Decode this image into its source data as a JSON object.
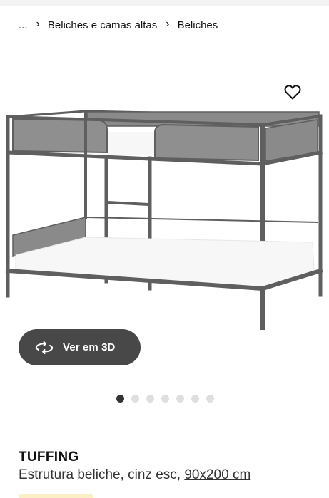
{
  "breadcrumb": {
    "ellipsis": "...",
    "items": [
      "Beliches e camas altas",
      "Beliches"
    ]
  },
  "icons": {
    "chevron": "chevron-right-icon",
    "favorite": "heart-outline-icon",
    "view3d": "rotate-3d-icon"
  },
  "view3d": {
    "label": "Ver em 3D"
  },
  "carousel": {
    "total": 7,
    "active": 1
  },
  "product": {
    "name": "TUFFING",
    "description": "Estrutura beliche, cinz esc, ",
    "size": "90x200 cm"
  },
  "colors": {
    "frame": "#5f5f5f",
    "mesh": "#8a8a8a",
    "mattress": "#f7f7f7",
    "button_bg": "#484848",
    "dot_active": "#333333",
    "dot_inactive": "#dfdfdf"
  }
}
